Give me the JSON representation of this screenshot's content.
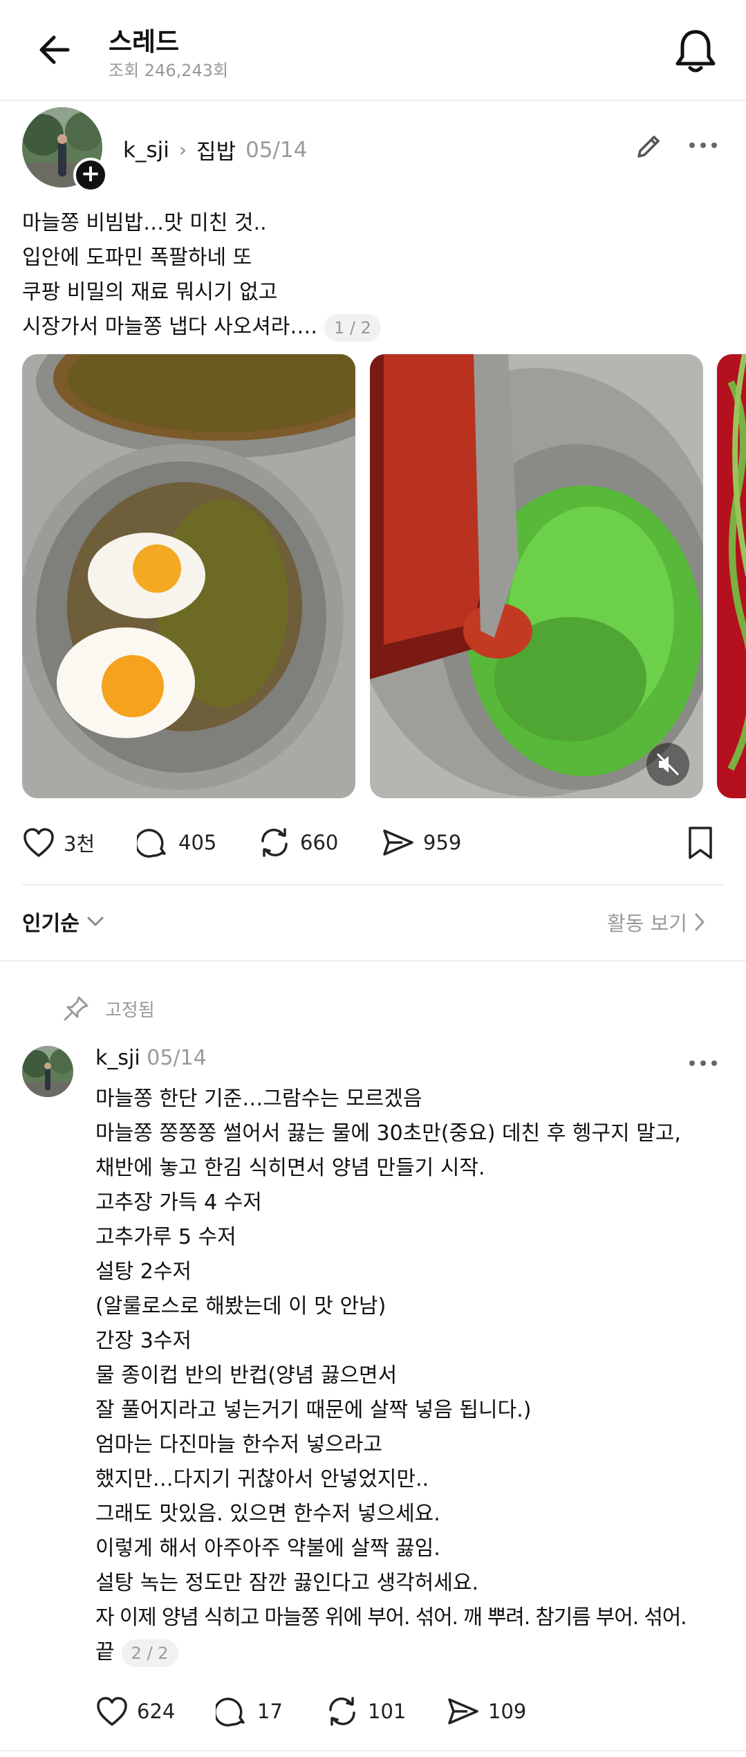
{
  "header": {
    "title": "스레드",
    "views": "조회 246,243회"
  },
  "post": {
    "username": "k_sji",
    "topic": "집밥",
    "date": "05/14",
    "lines": [
      "마늘쫑 비빔밥…맛 미친 것..",
      "입안에 도파민 폭팔하네 또",
      "쿠팡 비밀의 재료 뭐시기 없고",
      "시장가서 마늘쫑 냅다 사오셔라…."
    ],
    "page_indicator": "1 / 2",
    "actions": {
      "likes": "3천",
      "replies": "405",
      "reposts": "660",
      "shares": "959"
    }
  },
  "sort": {
    "label": "인기순",
    "activity_label": "활동 보기"
  },
  "pinned_label": "고정됨",
  "comment": {
    "username": "k_sji",
    "date": "05/14",
    "lines": [
      "마늘쫑 한단 기준…그람수는 모르겠음",
      "마늘쫑 쫑쫑쫑 썰어서 끓는 물에 30초만(중요) 데친 후 헹구지 말고,",
      "채반에 놓고 한김 식히면서 양념 만들기 시작.",
      "고추장 가득 4 수저",
      "고추가루 5 수저",
      "설탕 2수저",
      "(알룰로스로 해봤는데 이 맛 안남)",
      "간장 3수저",
      "물 종이컵 반의 반컵(양념 끓으면서",
      "잘 풀어지라고 넣는거기 때문에 살짝 넣음 됩니다.)",
      "엄마는 다진마늘 한수저 넣으라고",
      "했지만…다지기 귀찮아서 안넣었지만..",
      "그래도 맛있음. 있으면 한수저 넣으세요.",
      "이렇게 해서 아주아주 약불에 살짝 끓임.",
      "설탕 녹는 정도만 잠깐 끓인다고 생각허세요.",
      "자 이제 양념 식히고 마늘쫑 위에 부어. 섞어. 깨 뿌려. 참기름 부어. 섞어.",
      "끝"
    ],
    "page_indicator": "2 / 2",
    "actions": {
      "likes": "624",
      "replies": "17",
      "reposts": "101",
      "shares": "109"
    }
  }
}
